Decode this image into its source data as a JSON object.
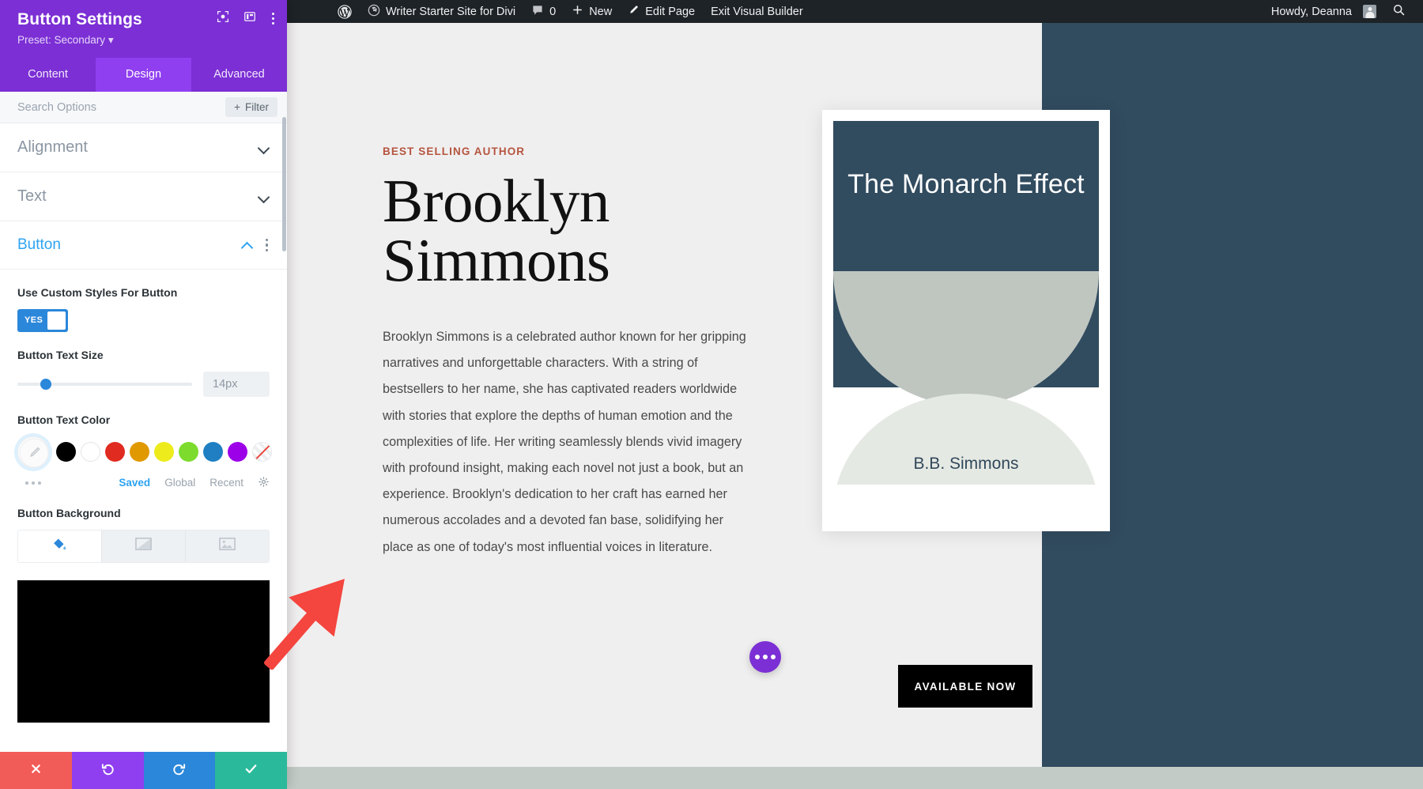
{
  "adminbar": {
    "wp_logo": "wordpress-logo-icon",
    "site_name": "Writer Starter Site for Divi",
    "comments_icon": "comment-bubble-icon",
    "comments_count": "0",
    "new_label": "New",
    "new_icon": "plus-icon",
    "edit_page_label": "Edit Page",
    "edit_icon": "pencil-icon",
    "exit_builder_label": "Exit Visual Builder",
    "howdy": "Howdy, Deanna",
    "avatar": "user-avatar-icon",
    "search_icon": "search-icon",
    "bg_color": "#1d2327"
  },
  "panel": {
    "title": "Button Settings",
    "preset": "Preset: Secondary",
    "header_icons": [
      "target-icon",
      "layout-panel-icon",
      "more-vertical-icon"
    ],
    "accent": "#7b2fd4",
    "tabs": [
      {
        "label": "Content",
        "active": false
      },
      {
        "label": "Design",
        "active": true
      },
      {
        "label": "Advanced",
        "active": false
      }
    ],
    "search": {
      "placeholder": "Search Options",
      "value": "",
      "filter_label": "Filter",
      "filter_icon": "plus-icon"
    },
    "sections": [
      {
        "label": "Alignment",
        "state": "collapsed",
        "icon": "chevron-down-icon"
      },
      {
        "label": "Text",
        "state": "collapsed",
        "icon": "chevron-down-icon"
      },
      {
        "label": "Button",
        "state": "expanded",
        "icon": "chevron-up-icon"
      }
    ],
    "fields": {
      "custom_styles_label": "Use Custom Styles For Button",
      "toggle_value": "YES",
      "text_size_label": "Button Text Size",
      "text_size_value": "14px",
      "text_color_label": "Button Text Color",
      "background_label": "Button Background",
      "swatch_colors": [
        "#000000",
        "#ffffff",
        "#e02b20",
        "#e09900",
        "#edeb1b",
        "#7cdb2c",
        "#1f7fc2",
        "#9b00e8"
      ],
      "swatch_none": "transparent-none-swatch",
      "picker_icon": "eyedropper-icon",
      "more_colors_icon": "more-horizontal-icon",
      "color_tabs": [
        {
          "label": "Saved",
          "active": true
        },
        {
          "label": "Global",
          "active": false
        },
        {
          "label": "Recent",
          "active": false
        }
      ],
      "color_settings_icon": "gear-icon",
      "bg_tabs": [
        {
          "icon": "paint-bucket-icon",
          "active": true
        },
        {
          "icon": "gradient-icon",
          "active": false
        },
        {
          "icon": "image-icon",
          "active": false
        }
      ],
      "bg_preview_color": "#000000"
    },
    "actions": [
      {
        "name": "cancel",
        "icon": "close-x-icon",
        "color": "#f15b58"
      },
      {
        "name": "undo",
        "icon": "undo-arrow-icon",
        "color": "#8f3ff0"
      },
      {
        "name": "redo",
        "icon": "redo-arrow-icon",
        "color": "#2b87da"
      },
      {
        "name": "save",
        "icon": "checkmark-icon",
        "color": "#2bb99b"
      }
    ]
  },
  "page": {
    "eyebrow": "BEST SELLING AUTHOR",
    "title_line1": "Brooklyn",
    "title_line2": "Simmons",
    "body": "Brooklyn Simmons is a celebrated author known for her gripping narratives and unforgettable characters. With a string of bestsellers to her name, she has captivated readers worldwide with stories that explore the depths of human emotion and the complexities of life. Her writing seamlessly blends vivid imagery with profound insight, making each novel not just a book, but an experience. Brooklyn's dedication to her craft has earned her numerous accolades and a devoted fan base, solidifying her place as one of today's most influential voices in literature.",
    "book": {
      "title": "The Monarch Effect",
      "author": "B.B. Simmons",
      "cover_dark": "#314b5f",
      "petal_upper": "#bfc6c0",
      "petal_lower": "#e5e9e3"
    },
    "cta_label": "AVAILABLE NOW",
    "fab_icon": "more-horizontal-icon",
    "bg_color": "#f0efef",
    "right_panel_color": "#314b5f",
    "bottom_strip_color": "#c2cbc5"
  },
  "annotation": {
    "arrow": "red-arrow-pointing-to-save-button",
    "arrow_color": "#f4453f"
  }
}
